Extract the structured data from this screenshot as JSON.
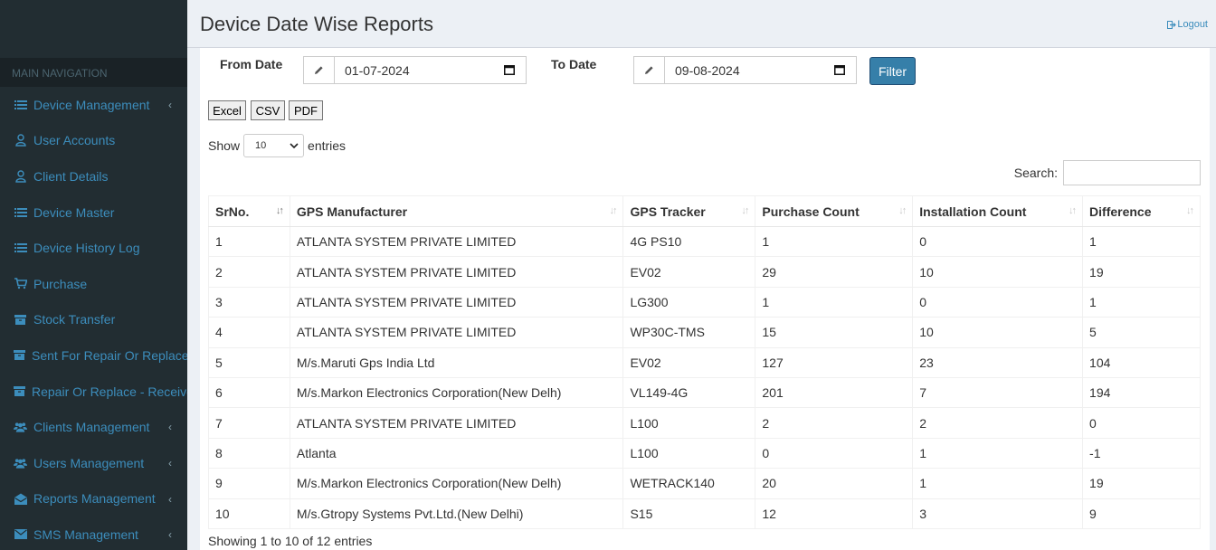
{
  "sidebar": {
    "header": "MAIN NAVIGATION",
    "items": [
      {
        "label": "Device Management",
        "icon": "list-icon",
        "chevron": "‹"
      },
      {
        "label": "User Accounts",
        "icon": "user-icon"
      },
      {
        "label": "Client Details",
        "icon": "user-icon"
      },
      {
        "label": "Device Master",
        "icon": "list-icon"
      },
      {
        "label": "Device History Log",
        "icon": "list-icon"
      },
      {
        "label": "Purchase",
        "icon": "cart-icon"
      },
      {
        "label": "Stock Transfer",
        "icon": "archive-icon"
      },
      {
        "label": "Sent For Repair Or Replace",
        "icon": "archive-icon"
      },
      {
        "label": "Repair Or Replace - Received",
        "icon": "archive-icon"
      },
      {
        "label": "Clients Management",
        "icon": "users-icon",
        "chevron": "‹"
      },
      {
        "label": "Users Management",
        "icon": "users-icon",
        "chevron": "‹"
      },
      {
        "label": "Reports Management",
        "icon": "envelope-open-icon",
        "chevron": "‹"
      },
      {
        "label": "SMS Management",
        "icon": "envelope-icon",
        "chevron": "‹"
      }
    ]
  },
  "header": {
    "title": "Device Date Wise Reports",
    "logout": "Logout"
  },
  "filters": {
    "from_label": "From Date",
    "from_value": "01-07-2024",
    "to_label": "To Date",
    "to_value": "09-08-2024",
    "filter_button": "Filter"
  },
  "export": {
    "excel": "Excel",
    "csv": "CSV",
    "pdf": "PDF"
  },
  "length": {
    "show": "Show",
    "value": "10",
    "entries": "entries"
  },
  "search": {
    "label": "Search:",
    "value": ""
  },
  "table": {
    "columns": [
      "SrNo.",
      "GPS Manufacturer",
      "GPS Tracker",
      "Purchase Count",
      "Installation Count",
      "Difference"
    ],
    "rows": [
      [
        "1",
        "ATLANTA SYSTEM PRIVATE LIMITED",
        "4G PS10",
        "1",
        "0",
        "1"
      ],
      [
        "2",
        "ATLANTA SYSTEM PRIVATE LIMITED",
        "EV02",
        "29",
        "10",
        "19"
      ],
      [
        "3",
        "ATLANTA SYSTEM PRIVATE LIMITED",
        "LG300",
        "1",
        "0",
        "1"
      ],
      [
        "4",
        "ATLANTA SYSTEM PRIVATE LIMITED",
        "WP30C-TMS",
        "15",
        "10",
        "5"
      ],
      [
        "5",
        "M/s.Maruti Gps India Ltd",
        "EV02",
        "127",
        "23",
        "104"
      ],
      [
        "6",
        "M/s.Markon Electronics Corporation(New Delh)",
        "VL149-4G",
        "201",
        "7",
        "194"
      ],
      [
        "7",
        "ATLANTA SYSTEM PRIVATE LIMITED",
        "L100",
        "2",
        "2",
        "0"
      ],
      [
        "8",
        "Atlanta",
        "L100",
        "0",
        "1",
        "-1"
      ],
      [
        "9",
        "M/s.Markon Electronics Corporation(New Delh)",
        "WETRACK140",
        "20",
        "1",
        "19"
      ],
      [
        "10",
        "M/s.Gtropy Systems Pvt.Ltd.(New Delhi)",
        "S15",
        "12",
        "3",
        "9"
      ]
    ]
  },
  "info": "Showing 1 to 10 of 12 entries",
  "colors": {
    "sidebar_bg": "#222d32",
    "link": "#3c8dbc",
    "primary_button": "#367fa9",
    "content_bg": "#ecf0f5"
  }
}
